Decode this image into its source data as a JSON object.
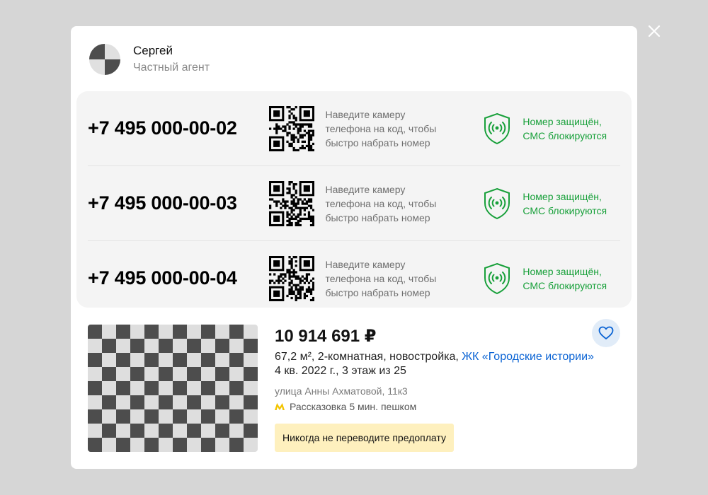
{
  "agent": {
    "name": "Сергей",
    "role": "Частный агент"
  },
  "phones": [
    {
      "number": "+7 495 000-00-02",
      "qr_hint": "Наведите камеру телефона на код, чтобы быстро набрать номер",
      "protection": "Номер защищён, СМС блокируются"
    },
    {
      "number": "+7 495 000-00-03",
      "qr_hint": "Наведите камеру телефона на код, чтобы быстро набрать номер",
      "protection": "Номер защищён, СМС блокируются"
    },
    {
      "number": "+7 495 000-00-04",
      "qr_hint": "Наведите камеру телефона на код, чтобы быстро набрать номер",
      "protection": "Номер защищён, СМС блокируются"
    }
  ],
  "listing": {
    "price": "10 914 691 ₽",
    "description": "67,2 м², 2-комнатная, новостройка, ",
    "complex_link": "ЖК «Городские истории»",
    "completion": "4 кв. 2022 г., 3 этаж из 25",
    "address": "улица Анны Ахматовой, 11к3",
    "metro": "Рассказовка 5 мин. пешком",
    "warning": "Никогда не переводите предоплату"
  },
  "icons": {
    "close": "close-icon",
    "avatar": "avatar-placeholder",
    "qr": "qr-code-icon",
    "shield": "shield-signal-icon",
    "favorite": "heart-icon",
    "metro": "metro-icon"
  },
  "colors": {
    "accent_green": "#18a03a",
    "link_blue": "#0a63d4",
    "metro_yellow": "#f3c400",
    "warning_bg": "#fef0be",
    "favorite_bg": "#e1ecf8"
  }
}
